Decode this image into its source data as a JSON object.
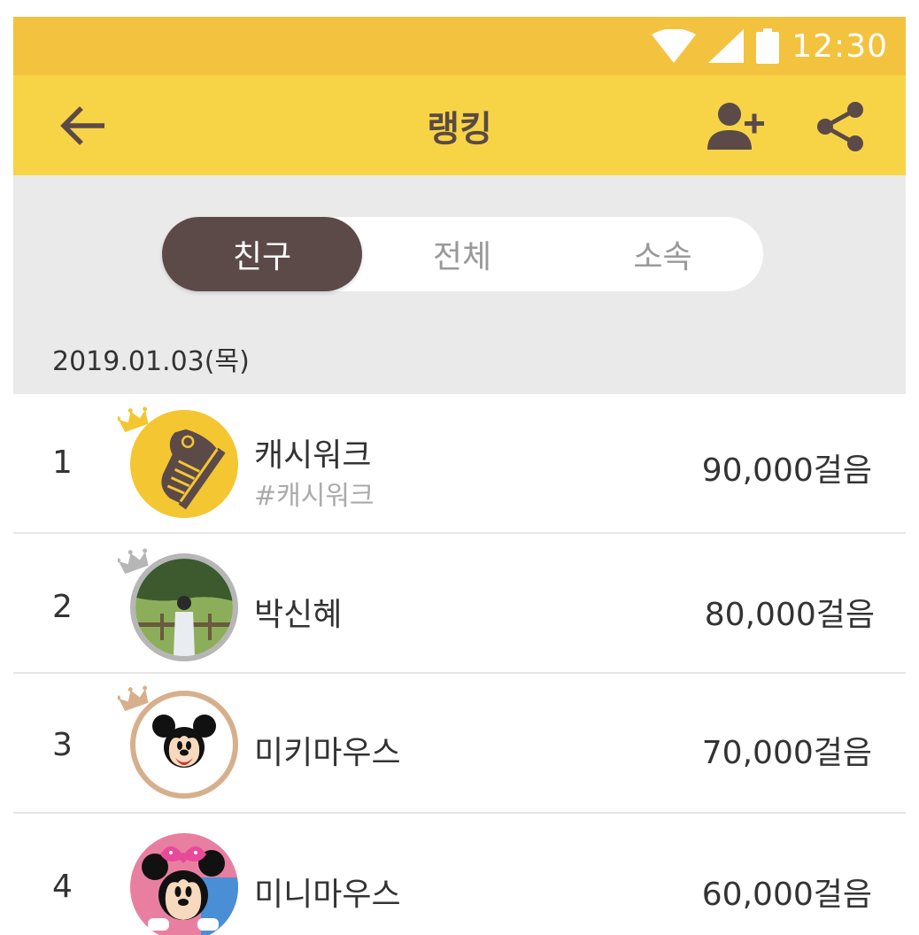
{
  "status_bar": {
    "time": "12:30",
    "icons": [
      "wifi-icon",
      "signal-icon",
      "battery-icon"
    ]
  },
  "header": {
    "title": "랭킹",
    "back_icon": "arrow-back-icon",
    "add_friend_icon": "person-add-icon",
    "share_icon": "share-icon"
  },
  "tabs": [
    {
      "label": "친구",
      "active": true
    },
    {
      "label": "전체",
      "active": false
    },
    {
      "label": "소속",
      "active": false
    }
  ],
  "date": "2019.01.03(목)",
  "ranking": [
    {
      "rank": "1",
      "name": "캐시워크",
      "tag": "#캐시워크",
      "steps": "90,000걸음",
      "crown": "gold"
    },
    {
      "rank": "2",
      "name": "박신혜",
      "tag": "",
      "steps": "80,000걸음",
      "crown": "silver"
    },
    {
      "rank": "3",
      "name": "미키마우스",
      "tag": "",
      "steps": "70,000걸음",
      "crown": "bronze"
    },
    {
      "rank": "4",
      "name": "미니마우스",
      "tag": "",
      "steps": "60,000걸음",
      "crown": ""
    }
  ],
  "colors": {
    "status_bar": "#F3C23E",
    "app_bar": "#F7D446",
    "brown": "#5B4A48",
    "gold": "#F4C631",
    "silver": "#B6B6B6",
    "bronze": "#D6AF8C"
  }
}
